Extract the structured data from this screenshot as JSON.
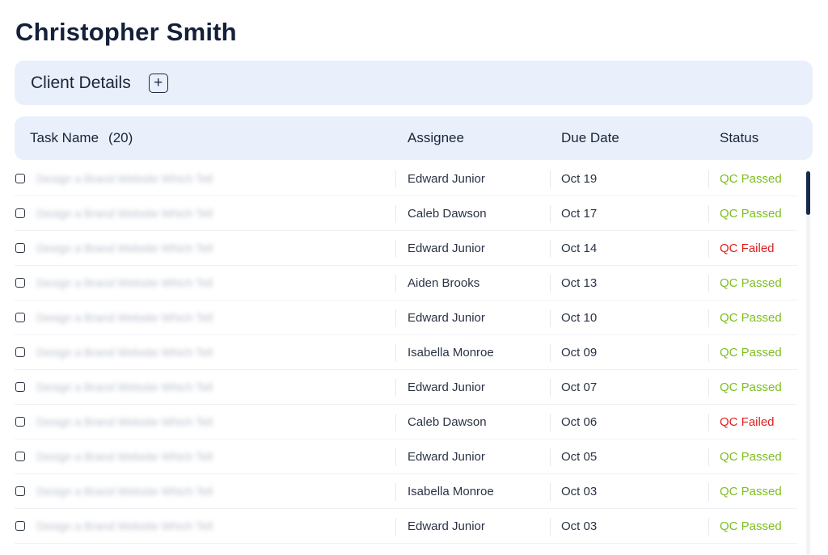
{
  "page": {
    "title": "Christopher Smith"
  },
  "client_details": {
    "label": "Client Details",
    "add_icon": "plus-square-icon"
  },
  "table": {
    "headers": {
      "task_name": "Task Name",
      "task_count": "(20)",
      "assignee": "Assignee",
      "due_date": "Due Date",
      "status": "Status"
    },
    "task_placeholder": "Design a Brand Website Which Tell",
    "rows": [
      {
        "assignee": "Edward Junior",
        "due": "Oct 19",
        "status": "QC Passed",
        "state": "passed"
      },
      {
        "assignee": "Caleb Dawson",
        "due": "Oct 17",
        "status": "QC Passed",
        "state": "passed"
      },
      {
        "assignee": "Edward Junior",
        "due": "Oct 14",
        "status": "QC Failed",
        "state": "failed"
      },
      {
        "assignee": "Aiden Brooks",
        "due": "Oct 13",
        "status": "QC Passed",
        "state": "passed"
      },
      {
        "assignee": "Edward Junior",
        "due": "Oct 10",
        "status": "QC Passed",
        "state": "passed"
      },
      {
        "assignee": "Isabella Monroe",
        "due": "Oct 09",
        "status": "QC Passed",
        "state": "passed"
      },
      {
        "assignee": "Edward Junior",
        "due": "Oct 07",
        "status": "QC Passed",
        "state": "passed"
      },
      {
        "assignee": "Caleb Dawson",
        "due": "Oct 06",
        "status": "QC Failed",
        "state": "failed"
      },
      {
        "assignee": "Edward Junior",
        "due": "Oct 05",
        "status": "QC Passed",
        "state": "passed"
      },
      {
        "assignee": "Isabella Monroe",
        "due": "Oct 03",
        "status": "QC Passed",
        "state": "passed"
      },
      {
        "assignee": "Edward Junior",
        "due": "Oct 03",
        "status": "QC Passed",
        "state": "passed"
      }
    ]
  },
  "colors": {
    "passed": "#7cbf1e",
    "failed": "#e0201d",
    "header_bg": "#e9f0fb",
    "scroll_thumb": "#162a4d"
  }
}
